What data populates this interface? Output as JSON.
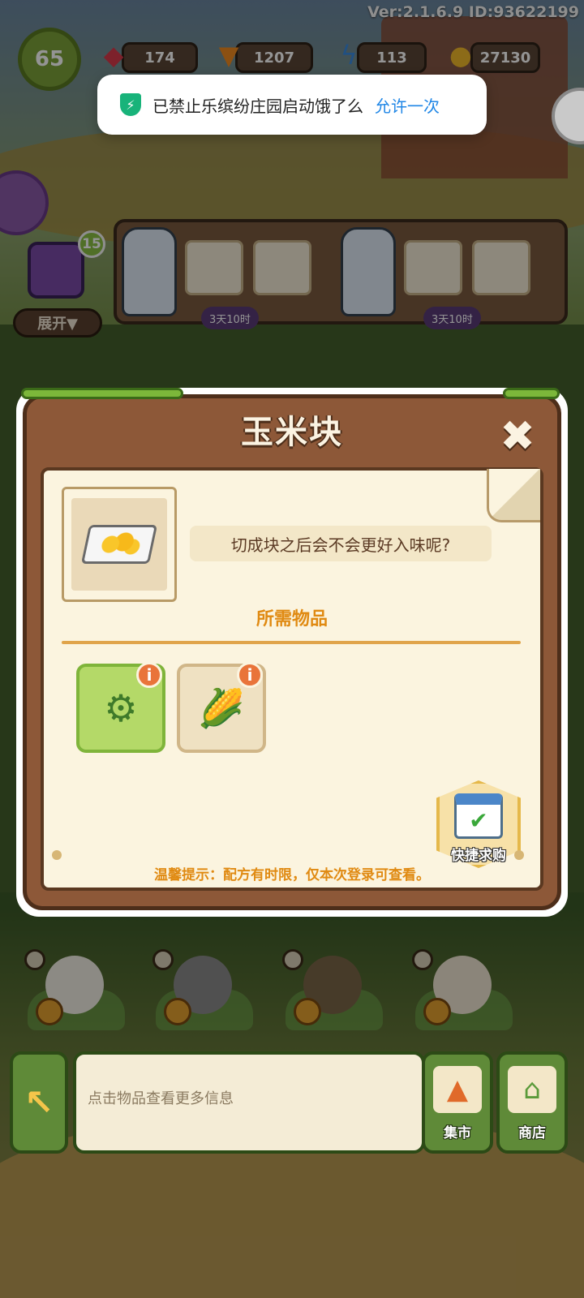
{
  "version_text": "Ver:2.1.6.9 ID:93622199",
  "player": {
    "level": "65"
  },
  "resources": [
    {
      "icon": "gem-icon",
      "value": "174",
      "color": "#d83a4a"
    },
    {
      "icon": "carrot-icon",
      "value": "1207",
      "color": "#f08a20"
    },
    {
      "icon": "lightning-icon",
      "value": "113",
      "color": "#3a8ae0"
    },
    {
      "icon": "coin-icon",
      "value": "27130",
      "color": "#f2b82a"
    }
  ],
  "toast": {
    "message": "已禁止乐缤纷庄园启动饿了么",
    "action": "允许一次",
    "accent": "#1f86e6"
  },
  "shelf": {
    "chest_badge": "15",
    "expand_label": "展开▼",
    "timers": [
      "3天10时",
      "3天10时"
    ]
  },
  "modal": {
    "title": "玉米块",
    "close_icon": "close-icon",
    "item_icon": "corn-nuggets-icon",
    "description": "切成块之后会不会更好入味呢?",
    "required_title": "所需物品",
    "required_items": [
      {
        "icon": "corn-cutter-machine-icon",
        "info": "i"
      },
      {
        "icon": "corn-icon",
        "info": "i"
      }
    ],
    "quick_buy_label": "快捷求购",
    "tip": "温馨提示：配方有时限，仅本次登录可查看。"
  },
  "bottom_bar": {
    "info_placeholder": "点击物品查看更多信息",
    "market_label": "集市",
    "shop_label": "商店"
  },
  "colors": {
    "modal_wood": "#8d5838",
    "paper": "#fbf4df",
    "accent_orange": "#e08a12",
    "green_button": "#5f8a38"
  }
}
